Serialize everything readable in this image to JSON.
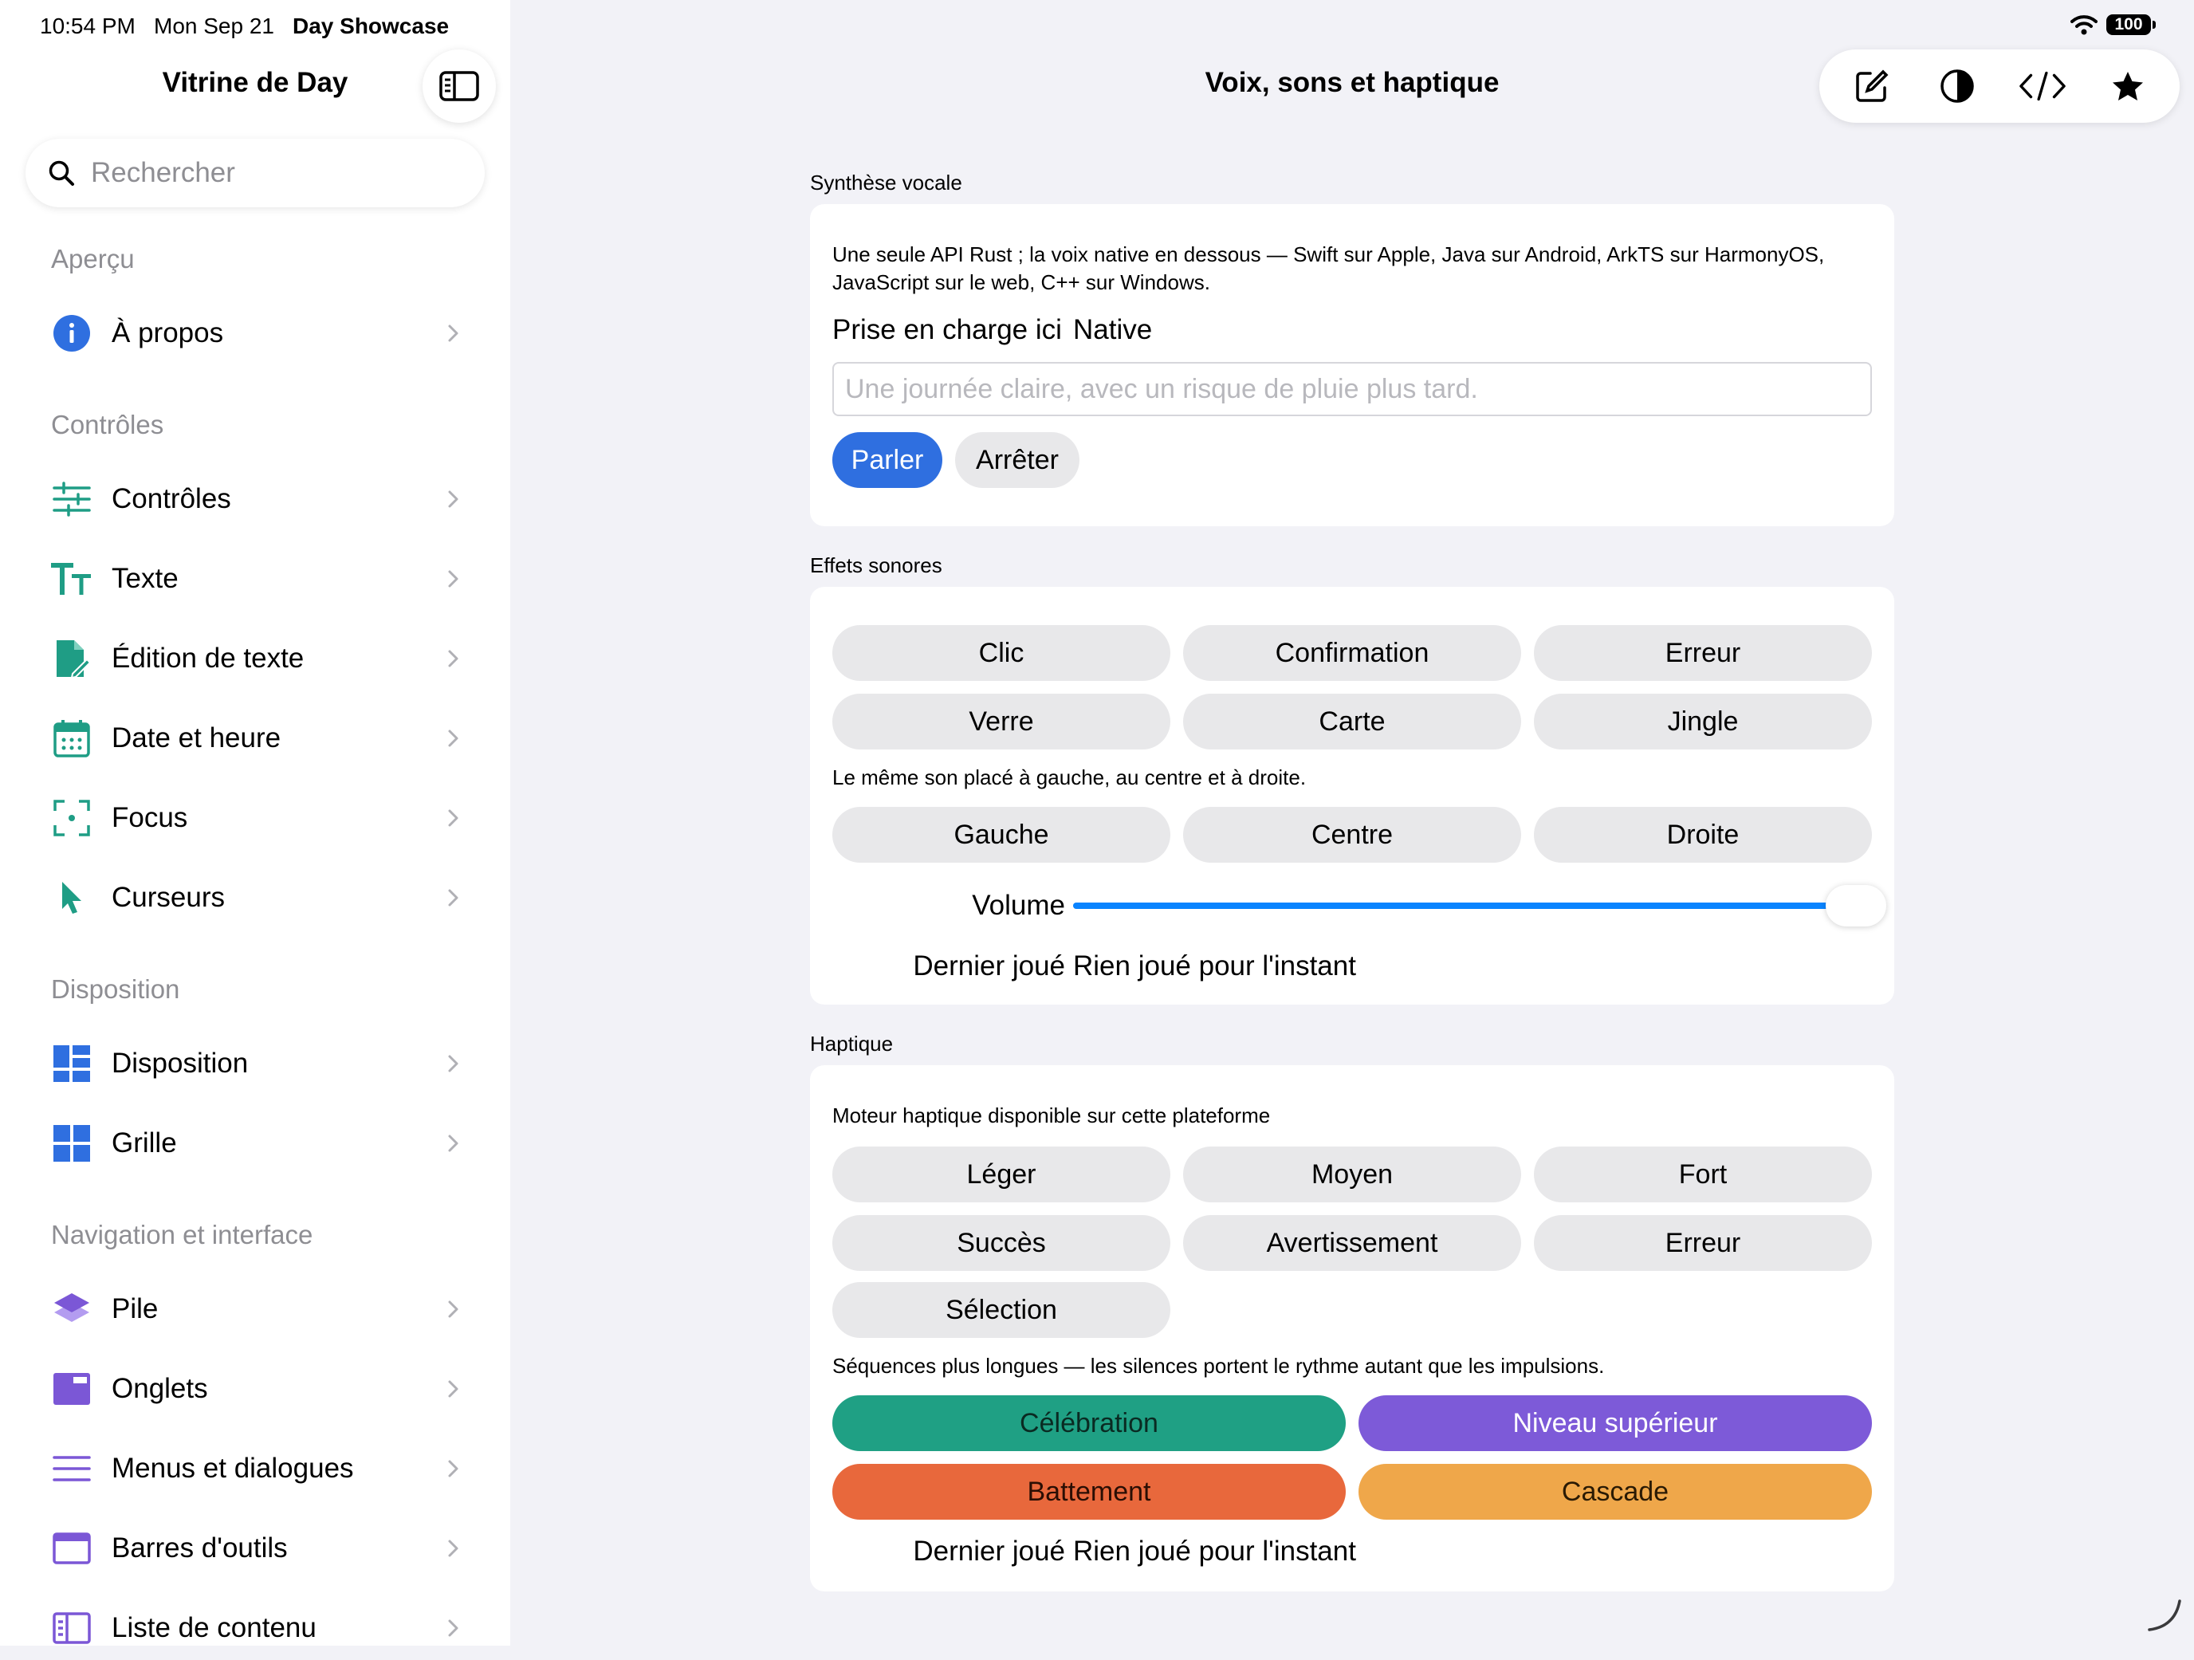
{
  "status": {
    "time": "10:54 PM",
    "date": "Mon Sep 21",
    "app": "Day Showcase",
    "battery": "100"
  },
  "sidebar": {
    "title": "Vitrine de Day",
    "search_placeholder": "Rechercher",
    "sections": [
      {
        "header": "Aperçu",
        "items": [
          {
            "label": "À propos",
            "icon": "info-icon",
            "color": "#2f6fe0"
          }
        ]
      },
      {
        "header": "Contrôles",
        "items": [
          {
            "label": "Contrôles",
            "icon": "sliders-icon",
            "color": "#1f9d85"
          },
          {
            "label": "Texte",
            "icon": "text-size-icon",
            "color": "#1f9d85"
          },
          {
            "label": "Édition de texte",
            "icon": "document-edit-icon",
            "color": "#1f9d85"
          },
          {
            "label": "Date et heure",
            "icon": "calendar-icon",
            "color": "#1f9d85"
          },
          {
            "label": "Focus",
            "icon": "focus-icon",
            "color": "#1f9d85"
          },
          {
            "label": "Curseurs",
            "icon": "cursor-icon",
            "color": "#1f9d85"
          }
        ]
      },
      {
        "header": "Disposition",
        "items": [
          {
            "label": "Disposition",
            "icon": "layout-icon",
            "color": "#2f6fe0"
          },
          {
            "label": "Grille",
            "icon": "grid-icon",
            "color": "#2f6fe0"
          }
        ]
      },
      {
        "header": "Navigation et interface",
        "items": [
          {
            "label": "Pile",
            "icon": "stack-icon",
            "color": "#7b57d6"
          },
          {
            "label": "Onglets",
            "icon": "tabs-icon",
            "color": "#7b57d6"
          },
          {
            "label": "Menus et dialogues",
            "icon": "menu-lines-icon",
            "color": "#7b57d6"
          },
          {
            "label": "Barres d'outils",
            "icon": "toolbar-window-icon",
            "color": "#7b57d6"
          },
          {
            "label": "Liste de contenu",
            "icon": "list-content-icon",
            "color": "#7b57d6"
          }
        ]
      }
    ]
  },
  "main": {
    "title": "Voix, sons et haptique",
    "toolbar": [
      "compose-icon",
      "contrast-icon",
      "code-icon",
      "star-icon"
    ],
    "speech": {
      "group_label": "Synthèse vocale",
      "description": "Une seule API Rust ; la voix native en dessous — Swift sur Apple, Java sur Android, ArkTS sur HarmonyOS, JavaScript sur le web, C++ sur Windows.",
      "support_label": "Prise en charge ici",
      "support_value": "Native",
      "input_placeholder": "Une journée claire, avec un risque de pluie plus tard.",
      "speak_label": "Parler",
      "stop_label": "Arrêter",
      "accent": "#2f6fe0"
    },
    "sounds": {
      "group_label": "Effets sonores",
      "buttons": [
        "Clic",
        "Confirmation",
        "Erreur",
        "Verre",
        "Carte",
        "Jingle"
      ],
      "pan_description": "Le même son placé à gauche, au centre et à droite.",
      "pan_buttons": [
        "Gauche",
        "Centre",
        "Droite"
      ],
      "volume_label": "Volume",
      "volume_value": 1.0,
      "last_label": "Dernier joué",
      "last_value": "Rien joué pour l'instant"
    },
    "haptics": {
      "group_label": "Haptique",
      "description": "Moteur haptique disponible sur cette plateforme",
      "buttons": [
        "Léger",
        "Moyen",
        "Fort",
        "Succès",
        "Avertissement",
        "Erreur",
        "Sélection"
      ],
      "sequence_description": "Séquences plus longues — les silences portent le rythme autant que les impulsions.",
      "sequences": [
        {
          "label": "Célébration",
          "color": "#1fa084",
          "text_color": "#0a2a22"
        },
        {
          "label": "Niveau supérieur",
          "color": "#7d5ad8",
          "text_color": "#ffffff"
        },
        {
          "label": "Battement",
          "color": "#e8683c",
          "text_color": "#2a0e04"
        },
        {
          "label": "Cascade",
          "color": "#efa74a",
          "text_color": "#2a1a04"
        }
      ],
      "last_label": "Dernier joué",
      "last_value": "Rien joué pour l'instant"
    }
  }
}
